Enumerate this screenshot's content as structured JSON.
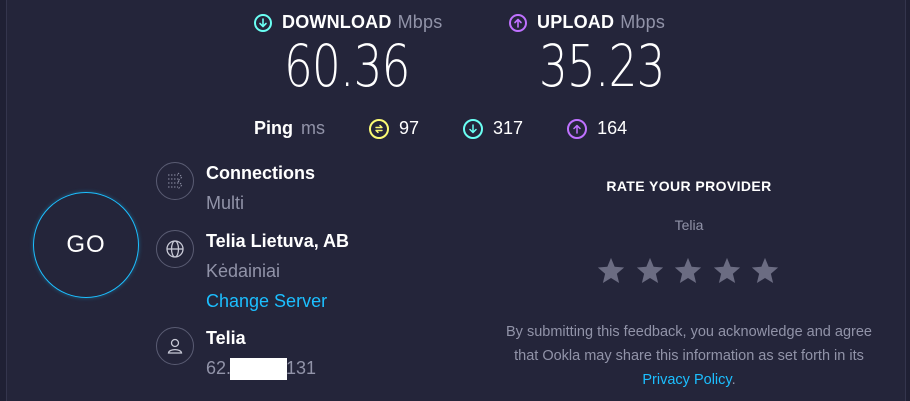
{
  "download": {
    "label": "DOWNLOAD",
    "unit": "Mbps",
    "value": "60.36",
    "icon": "arrow-down-circle-icon",
    "color": "#6afff3"
  },
  "upload": {
    "label": "UPLOAD",
    "unit": "Mbps",
    "value": "35.23",
    "icon": "arrow-up-circle-icon",
    "color": "#bf71ff"
  },
  "ping": {
    "label": "Ping",
    "unit": "ms",
    "idle": {
      "icon": "ping-idle-icon",
      "value": "97",
      "color": "#fbfa74"
    },
    "download": {
      "icon": "ping-download-icon",
      "value": "317",
      "color": "#6afff3"
    },
    "upload": {
      "icon": "ping-upload-icon",
      "value": "164",
      "color": "#bf71ff"
    }
  },
  "go_button": {
    "label": "GO"
  },
  "connections": {
    "icon": "connections-icon",
    "title": "Connections",
    "value": "Multi"
  },
  "server": {
    "icon": "globe-icon",
    "name": "Telia Lietuva, AB",
    "location": "Kėdainiai",
    "change_link": "Change Server"
  },
  "isp": {
    "icon": "user-icon",
    "name": "Telia",
    "ip_prefix": "62.",
    "ip_suffix": "131"
  },
  "rate_provider": {
    "title": "RATE YOUR PROVIDER",
    "provider": "Telia",
    "stars": 5,
    "rating": 0,
    "disclaimer": "By submitting this feedback, you acknowledge and agree that Ookla may share this information as set forth in its ",
    "privacy_link": "Privacy Policy",
    "disclaimer_end": "."
  }
}
